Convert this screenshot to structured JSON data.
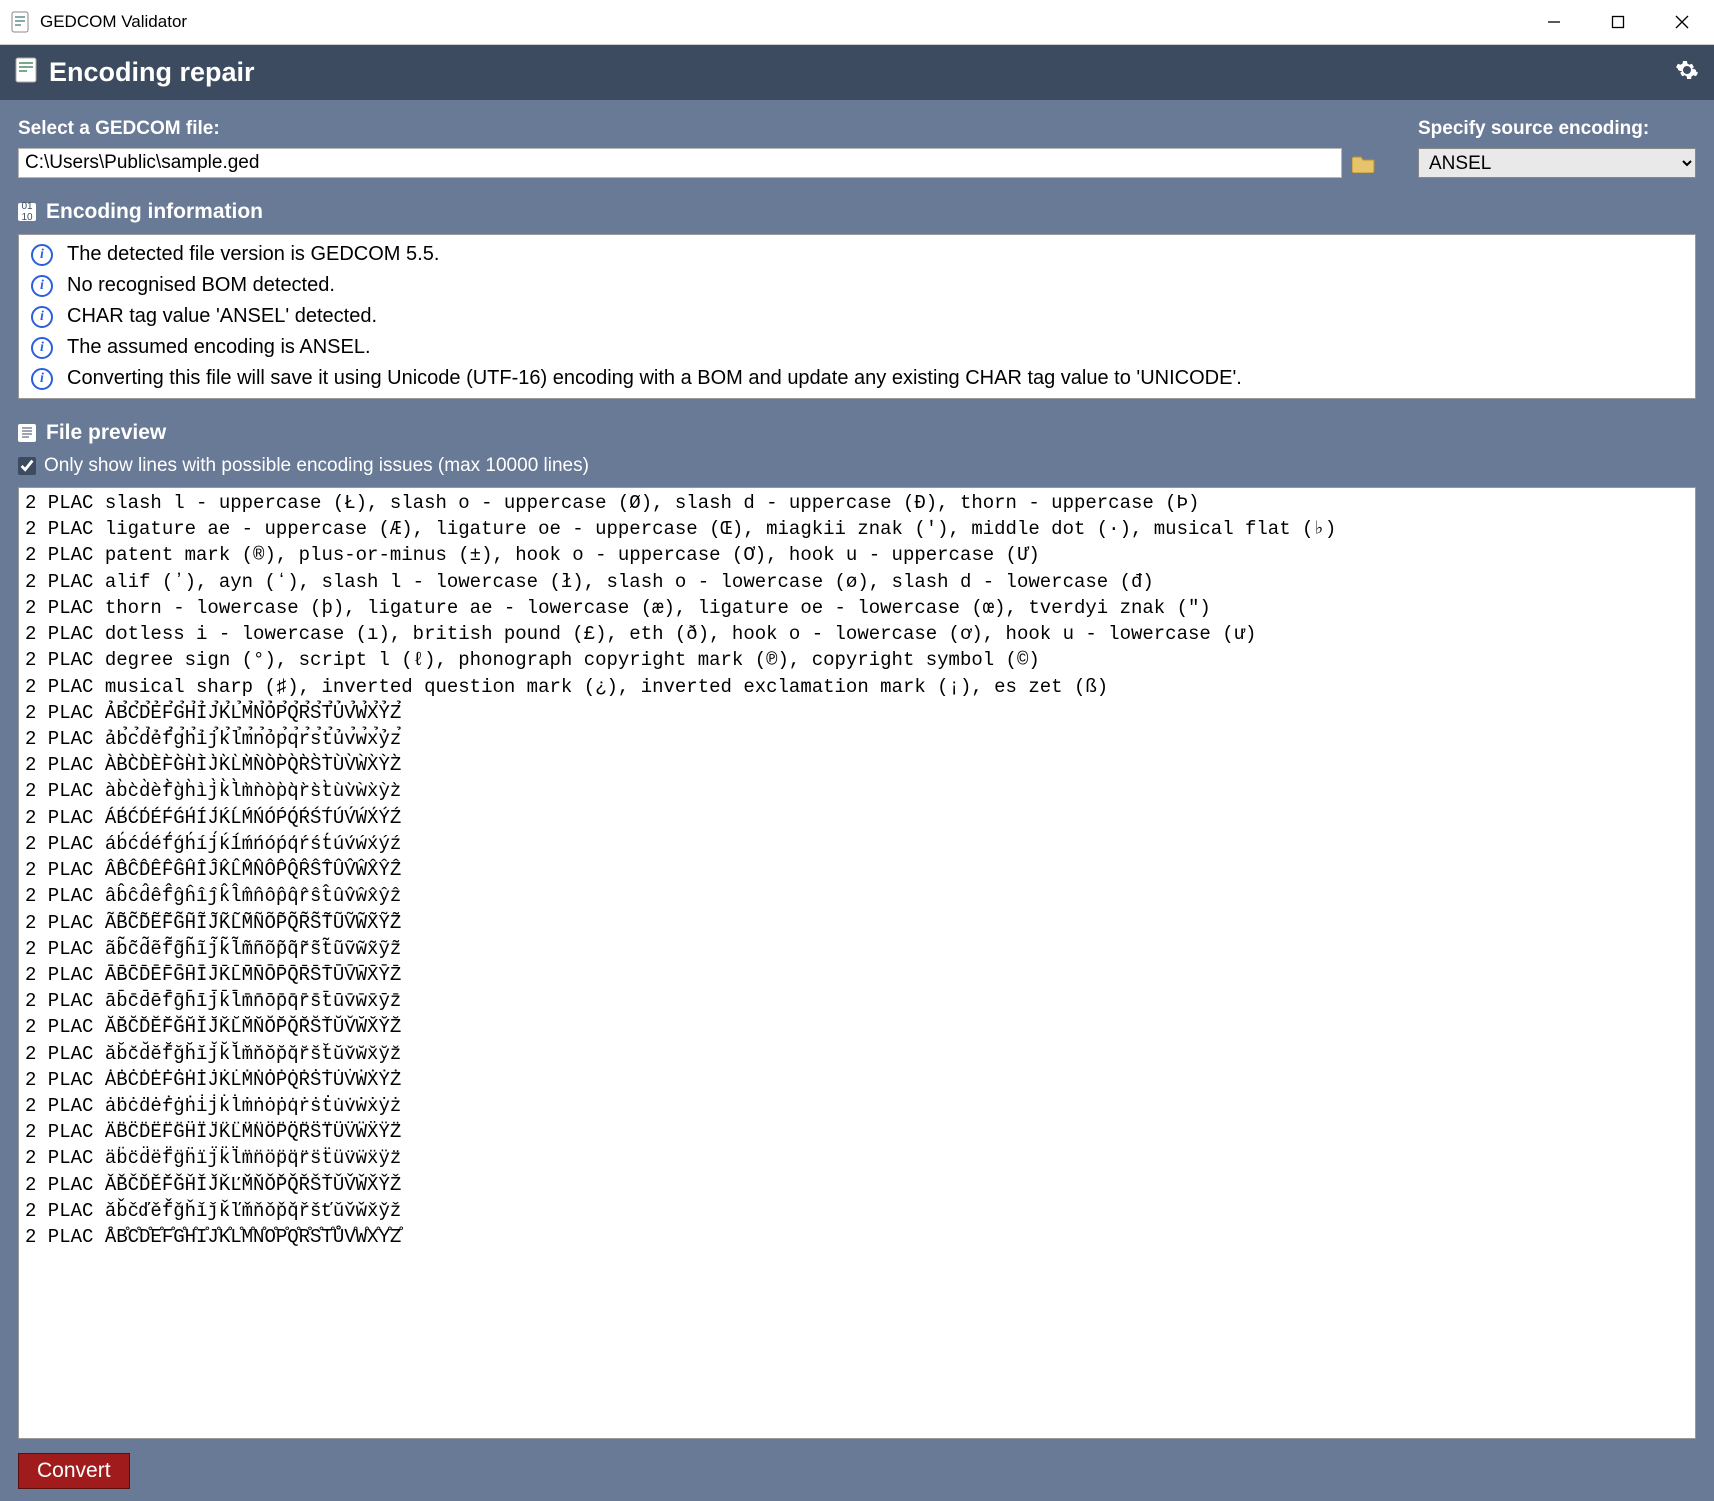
{
  "window": {
    "title": "GEDCOM Validator"
  },
  "banner": {
    "title": "Encoding repair"
  },
  "file_select": {
    "label": "Select a GEDCOM file:",
    "path": "C:\\Users\\Public\\sample.ged"
  },
  "encoding_select": {
    "label": "Specify source encoding:",
    "value": "ANSEL"
  },
  "encoding_info": {
    "header": "Encoding information",
    "lines": [
      "The detected file version is GEDCOM 5.5.",
      "No recognised BOM detected.",
      "CHAR tag value 'ANSEL' detected.",
      "The assumed encoding is ANSEL.",
      "Converting this file will save it using Unicode (UTF-16) encoding with a BOM and update any existing CHAR tag value to 'UNICODE'."
    ]
  },
  "preview": {
    "header": "File preview",
    "filter_label": "Only show lines with possible encoding issues (max 10000 lines)",
    "filter_checked": true,
    "lines": [
      "2 PLAC slash l - uppercase (Ł), slash o - uppercase (Ø), slash d - uppercase (Đ), thorn - uppercase (Þ)",
      "2 PLAC ligature ae - uppercase (Æ), ligature oe - uppercase (Œ), miagkii znak (ʹ), middle dot (·), musical flat (♭)",
      "2 PLAC patent mark (®), plus-or-minus (±), hook o - uppercase (Ơ), hook u - uppercase (Ư)",
      "2 PLAC alif (ʼ), ayn (ʻ), slash l - lowercase (ł), slash o - lowercase (ø), slash d - lowercase (đ)",
      "2 PLAC thorn - lowercase (þ), ligature ae - lowercase (æ), ligature oe - lowercase (œ), tverdyi znak (ʺ)",
      "2 PLAC dotless i - lowercase (ı), british pound (£), eth (ð), hook o - lowercase (ơ), hook u - lowercase (ư)",
      "2 PLAC degree sign (°), script l (ℓ), phonograph copyright mark (℗), copyright symbol (©)",
      "2 PLAC musical sharp (♯), inverted question mark (¿), inverted exclamation mark (¡), es zet (ß)",
      "2 PLAC ẢB̉C̉D̉ẺF̉G̉H̉ỈJ̉K̉L̉M̉N̉ỎP̉Q̉R̉S̉T̉ỦV̉W̉X̉ỶZ̉",
      "2 PLAC ảb̉c̉d̉ẻf̉g̉h̉ỉj̉k̉l̉m̉n̉ỏp̉q̉r̉s̉t̉ủv̉w̉x̉ỷz̉",
      "2 PLAC ÀB̀C̀D̀ÈF̀G̀H̀ÌJ̀K̀L̀M̀ǸÒP̀Q̀R̀S̀T̀ÙV̀ẀX̀ỲZ̀",
      "2 PLAC àb̀c̀d̀èf̀g̀h̀ìj̀k̀l̀m̀ǹòp̀q̀r̀s̀t̀ùv̀ẁx̀ỳz̀",
      "2 PLAC ÁB́ĆD́ÉF́ǴH́ÍJ́ḰĹḾŃÓṔQ́ŔŚT́ÚV́ẂX́ÝŹ",
      "2 PLAC áb́ćd́éf́ǵh́íj́ḱĺḿńóṕq́ŕśt́úv́ẃx́ýź",
      "2 PLAC ÂB̂ĈD̂ÊF̂ĜĤÎĴK̂L̂M̂N̂ÔP̂Q̂R̂ŜT̂ÛV̂ŴX̂ŶẐ",
      "2 PLAC âb̂ĉd̂êf̂ĝĥîĵk̂l̂m̂n̂ôp̂q̂r̂ŝt̂ûv̂ŵx̂ŷẑ",
      "2 PLAC ÃB̃C̃D̃ẼF̃G̃H̃ĨJ̃K̃L̃M̃ÑÕP̃Q̃R̃S̃T̃ŨṼW̃X̃ỸZ̃",
      "2 PLAC ãb̃c̃d̃ẽf̃g̃h̃ĩj̃k̃l̃m̃ñõp̃q̃r̃s̃t̃ũṽw̃x̃ỹz̃",
      "2 PLAC ĀB̄C̄D̄ĒF̄ḠH̄ĪJ̄K̄L̄M̄N̄ŌP̄Q̄R̄S̄T̄ŪV̄W̄X̄ȲZ̄",
      "2 PLAC āb̄c̄d̄ēf̄ḡh̄īj̄k̄l̄m̄n̄ōp̄q̄r̄s̄t̄ūv̄w̄x̄ȳz̄",
      "2 PLAC ĂB̆C̆D̆ĔF̆ĞH̆ĬJ̆K̆L̆M̆N̆ŎP̆Q̆R̆S̆T̆ŬV̆W̆X̆Y̆Z̆",
      "2 PLAC ăb̆c̆d̆ĕf̆ğh̆ĭj̆k̆l̆m̆n̆ŏp̆q̆r̆s̆t̆ŭv̆w̆x̆y̆z̆",
      "2 PLAC ȦḂĊḊĖḞĠḢİJ̇K̇L̇ṀṄȮṖQ̇ṘṠṪU̇V̇ẆẊẎŻ",
      "2 PLAC ȧḃċḋėḟġḣi̇j̇k̇l̇ṁṅȯṗq̇ṙṡṫu̇v̇ẇẋẏż",
      "2 PLAC ÄB̈C̈D̈ËF̈G̈ḦÏJ̈K̈L̈M̈N̈ÖP̈Q̈R̈S̈T̈ÜV̈ẄẌŸZ̈",
      "2 PLAC äb̈c̈d̈ëf̈g̈ḧïj̈k̈l̈m̈n̈öp̈q̈r̈s̈ẗüv̈ẅẍÿz̈",
      "2 PLAC ǍB̌ČĎĚF̌ǦȞǏJ̌ǨĽM̌ŇǑP̌Q̌ŘŠŤǓV̌W̌X̌Y̌Ž",
      "2 PLAC ǎb̌čďěf̌ǧȟǐǰǩľm̌ňǒp̌q̌řšťǔv̌w̌x̌y̌ž",
      "2 PLAC ÅB̊C̊D̊E̊F̊G̊H̊I̊J̊K̊L̊M̊N̊O̊P̊Q̊R̊S̊T̊ŮV̊W̊X̊Y̊Z̊"
    ]
  },
  "convert": {
    "label": "Convert"
  }
}
